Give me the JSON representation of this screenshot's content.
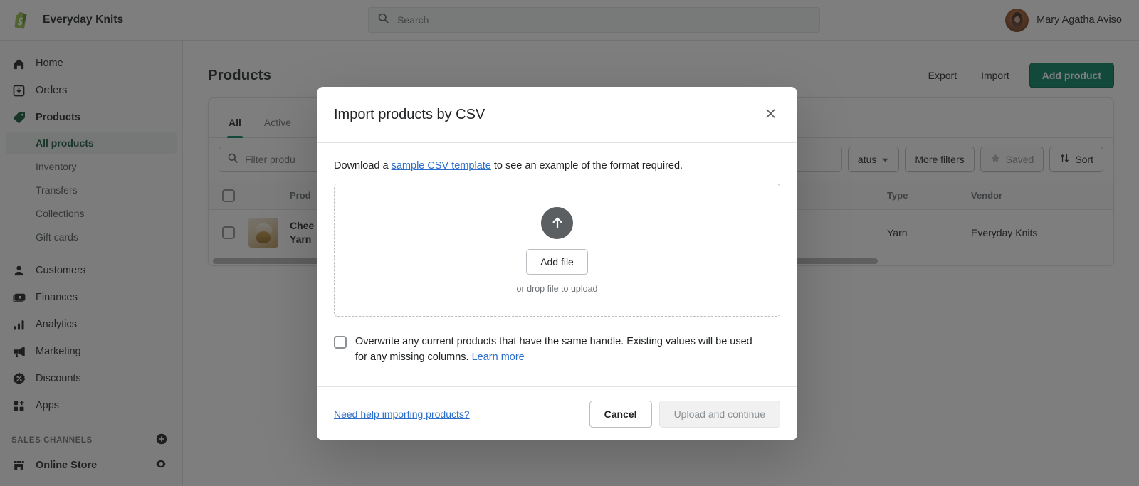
{
  "topbar": {
    "store_name": "Everyday Knits",
    "logo_icon": "shopify-bag-icon",
    "search": {
      "placeholder": "Search",
      "icon": "search-icon"
    },
    "user_name": "Mary Agatha Aviso"
  },
  "sidebar": {
    "items": [
      {
        "label": "Home",
        "icon": "home-icon"
      },
      {
        "label": "Orders",
        "icon": "orders-inbox-icon"
      },
      {
        "label": "Products",
        "icon": "product-tag-icon",
        "active": true
      }
    ],
    "sub_items": [
      {
        "label": "All products",
        "active": true
      },
      {
        "label": "Inventory",
        "active": false
      },
      {
        "label": "Transfers",
        "active": false
      },
      {
        "label": "Collections",
        "active": false
      },
      {
        "label": "Gift cards",
        "active": false
      }
    ],
    "items2": [
      {
        "label": "Customers",
        "icon": "person-icon"
      },
      {
        "label": "Finances",
        "icon": "cash-icon"
      },
      {
        "label": "Analytics",
        "icon": "bar-chart-icon"
      },
      {
        "label": "Marketing",
        "icon": "megaphone-icon"
      },
      {
        "label": "Discounts",
        "icon": "discount-badge-icon"
      },
      {
        "label": "Apps",
        "icon": "apps-grid-icon"
      }
    ],
    "sales_channels": {
      "title": "SALES CHANNELS",
      "add_icon": "plus-circle-icon",
      "channels": [
        {
          "label": "Online Store",
          "icon": "storefront-icon",
          "trailing_icon": "eye-icon"
        }
      ]
    }
  },
  "page": {
    "title": "Products",
    "actions": {
      "export": "Export",
      "import": "Import",
      "add_product": "Add product"
    },
    "tabs": [
      {
        "label": "All",
        "active": true
      },
      {
        "label": "Active",
        "active": false
      }
    ],
    "filter": {
      "placeholder": "Filter produ",
      "search_icon": "search-icon",
      "status_label": "atus",
      "status_icon": "chevron-down-icon",
      "more_filters": "More filters",
      "saved": "Saved",
      "saved_icon": "star-icon",
      "sort": "Sort",
      "sort_icon": "sort-arrows-icon"
    },
    "table": {
      "headers": {
        "product": "Prod",
        "type": "Type",
        "vendor": "Vendor"
      },
      "rows": [
        {
          "product_line1": "Chee",
          "product_line2": "Yarn",
          "type": "Yarn",
          "vendor": "Everyday Knits",
          "thumb_icon": "product-thumbnail"
        }
      ]
    }
  },
  "modal": {
    "title": "Import products by CSV",
    "close_icon": "close-icon",
    "hint_before": "Download a ",
    "hint_link": "sample CSV template",
    "hint_after": " to see an example of the format required.",
    "dropzone": {
      "upload_icon": "upload-arrow-icon",
      "add_file": "Add file",
      "drop_hint": "or drop file to upload"
    },
    "overwrite_text": "Overwrite any current products that have the same handle. Existing values will be used for any missing columns. ",
    "learn_more": "Learn more",
    "footer": {
      "help_link": "Need help importing products?",
      "cancel": "Cancel",
      "upload": "Upload and continue"
    }
  },
  "colors": {
    "brand_green": "#008060",
    "active_green": "#0c5132",
    "link_blue": "#2c6ecb",
    "overlay": "rgba(33,33,33,.58)"
  }
}
